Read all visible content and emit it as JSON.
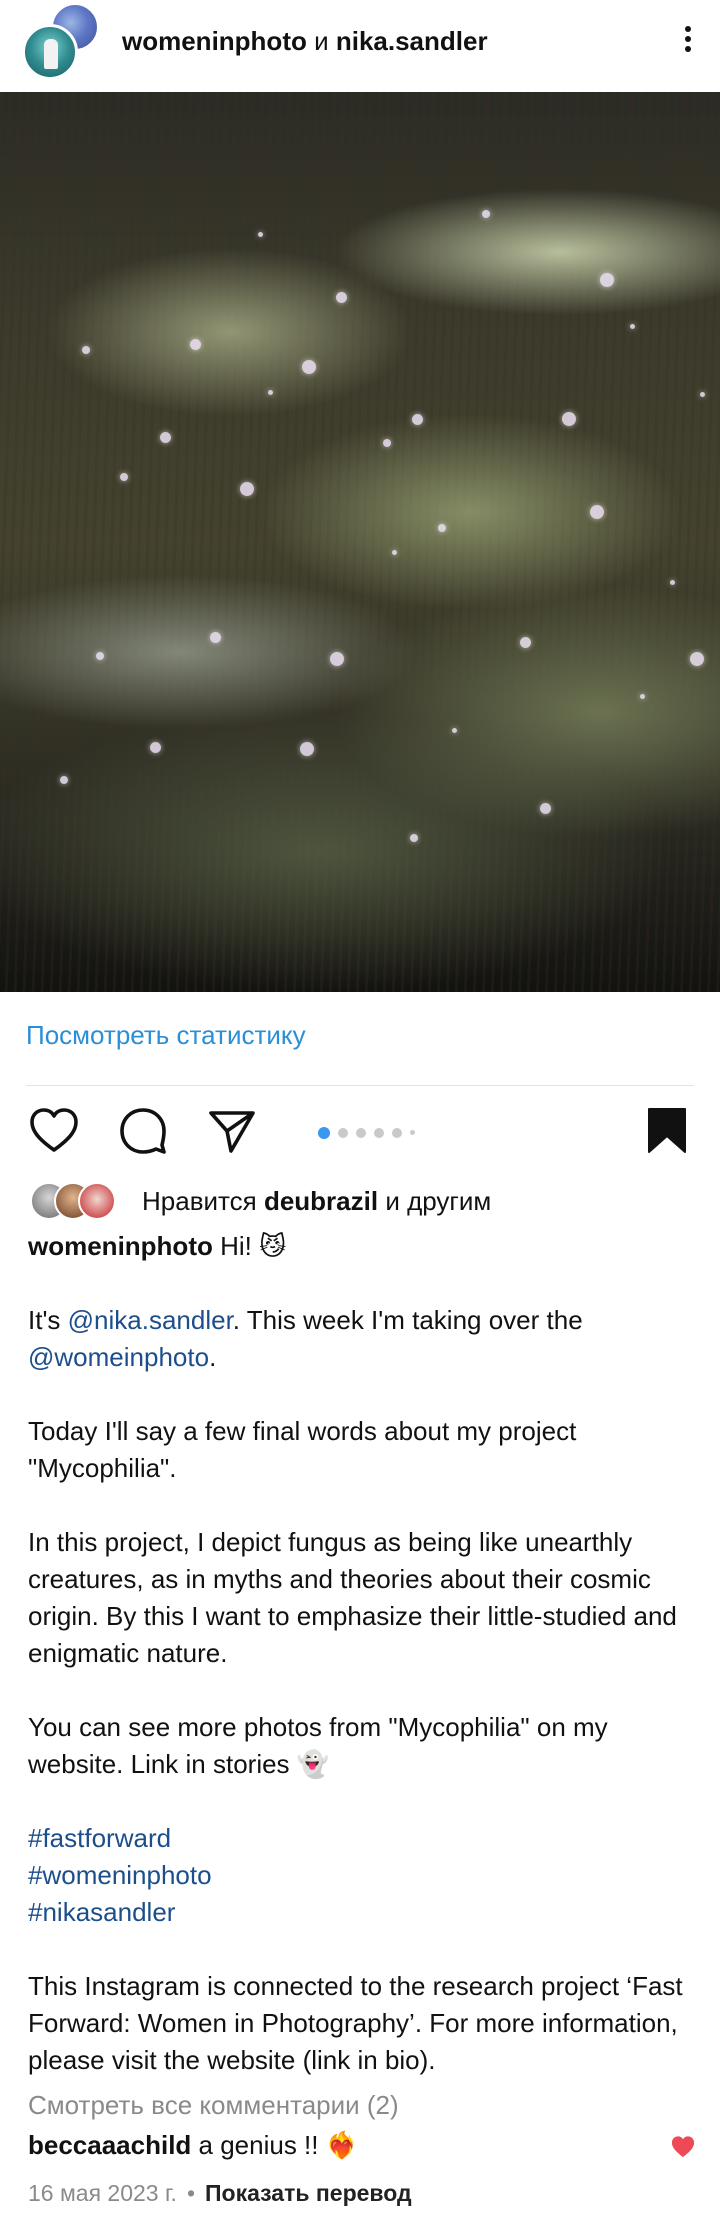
{
  "header": {
    "account1": "womeninphoto",
    "joiner": " и ",
    "account2": "nika.sandler"
  },
  "stats_link": "Посмотреть статистику",
  "carousel": {
    "current": 1,
    "total": 6
  },
  "likes": {
    "prefix": "Нравится ",
    "user": "deubrazil",
    "suffix": " и другим"
  },
  "caption": {
    "author": "womeninphoto",
    "line1": " Hi! 😼",
    "p1_a": "It's ",
    "p1_mention1": "@nika.sandler",
    "p1_b": ". This week I'm taking over the ",
    "p1_mention2": "@womeinphoto",
    "p1_c": ".",
    "p2": "Today I'll say a few final words about my project \"Mycophilia\".",
    "p3": "In this project, I depict fungus as being like unearthly creatures, as in myths and theories about their cosmic origin. By this I want to emphasize their little-studied and enigmatic nature.",
    "p4": "You can see more photos from \"Mycophilia\" on my website. Link in stories 👻",
    "tags": [
      "#fastforward",
      "#womeninphoto",
      "#nikasandler"
    ],
    "p5": "This Instagram is connected to the research project ‘Fast Forward: Women in Photography’. For more information, please visit the website (link in bio)."
  },
  "view_comments": "Смотреть все комментарии (2)",
  "comment": {
    "user": "beccaaachild",
    "text": " a genius !! ❤️‍🔥"
  },
  "meta": {
    "date": "16 мая 2023 г.",
    "separator": "•",
    "translate": "Показать перевод"
  },
  "colors": {
    "link_blue": "#2a8fd6",
    "mention_blue": "#1d4e8c",
    "heart_red": "#ed4956",
    "dot_active": "#3897f0"
  }
}
